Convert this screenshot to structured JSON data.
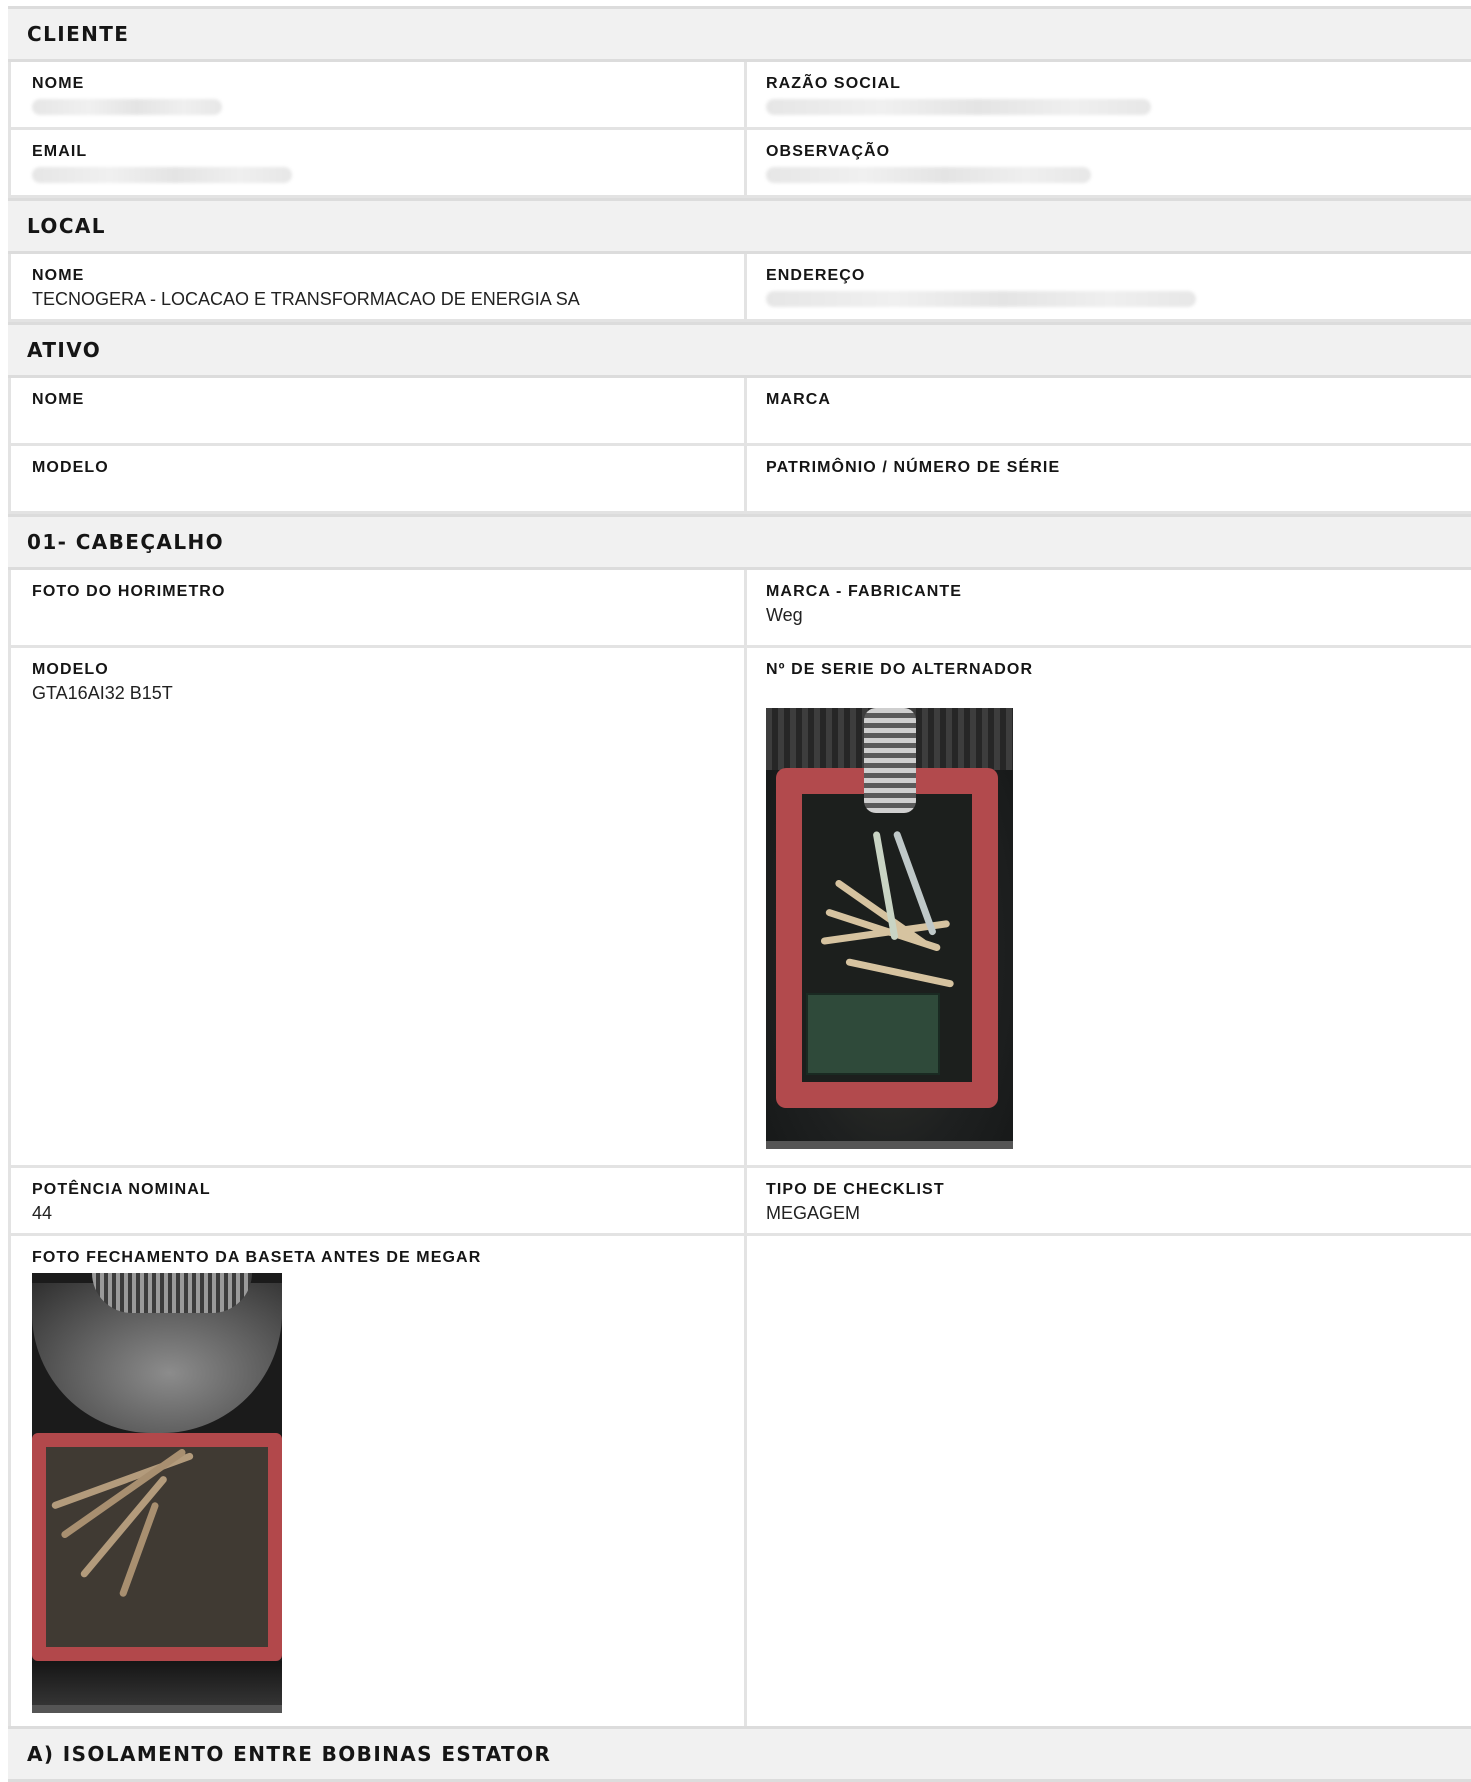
{
  "sections": {
    "cliente": {
      "title": "CLIENTE",
      "nome_label": "NOME",
      "razao_label": "RAZÃO SOCIAL",
      "email_label": "EMAIL",
      "obs_label": "OBSERVAÇÃO"
    },
    "local": {
      "title": "LOCAL",
      "nome_label": "NOME",
      "nome_value": "TECNOGERA - LOCACAO E TRANSFORMACAO DE ENERGIA SA",
      "endereco_label": "ENDEREÇO"
    },
    "ativo": {
      "title": "ATIVO",
      "nome_label": "NOME",
      "marca_label": "MARCA",
      "modelo_label": "MODELO",
      "patrimonio_label": "PATRIMÔNIO / NÚMERO DE SÉRIE"
    },
    "cabecalho": {
      "title": "01- CABEÇALHO",
      "foto_horimetro_label": "FOTO DO HORIMETRO",
      "marca_label": "MARCA - FABRICANTE",
      "marca_value": "Weg",
      "modelo_label": "MODELO",
      "modelo_value": "GTA16AI32 B15T",
      "serie_label": "Nº DE SERIE DO ALTERNADOR",
      "potencia_label": "POTÊNCIA NOMINAL",
      "potencia_value": "44",
      "tipo_label": "TIPO DE CHECKLIST",
      "tipo_value": "MEGAGEM",
      "foto_baseta_label": "FOTO FECHAMENTO DA BASETA ANTES DE MEGAR"
    },
    "isolamento": {
      "title": "A) ISOLAMENTO ENTRE BOBINAS ESTATOR"
    }
  }
}
